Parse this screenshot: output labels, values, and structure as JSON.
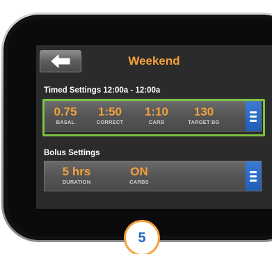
{
  "screen": {
    "title": "Weekend",
    "back_icon": "back-arrow-icon"
  },
  "timed_settings": {
    "label": "Timed Settings 12:00a - 12:00a",
    "values": [
      {
        "value": "0.75",
        "label": "BASAL"
      },
      {
        "value": "1:50",
        "label": "CORRECT"
      },
      {
        "value": "1:10",
        "label": "CARB"
      },
      {
        "value": "130",
        "label": "TARGET BG"
      }
    ],
    "menu_icon": "menu-icon"
  },
  "bolus_settings": {
    "label": "Bolus Settings",
    "values": [
      {
        "value": "5 hrs",
        "label": "DURATION"
      },
      {
        "value": "ON",
        "label": "CARBS"
      }
    ],
    "menu_icon": "menu-icon"
  },
  "step_badge": "5",
  "colors": {
    "accent": "#f4a23a",
    "highlight": "#7dc242",
    "menu_blue": "#1f5fb8",
    "screen_bg": "#2b2b2b"
  }
}
